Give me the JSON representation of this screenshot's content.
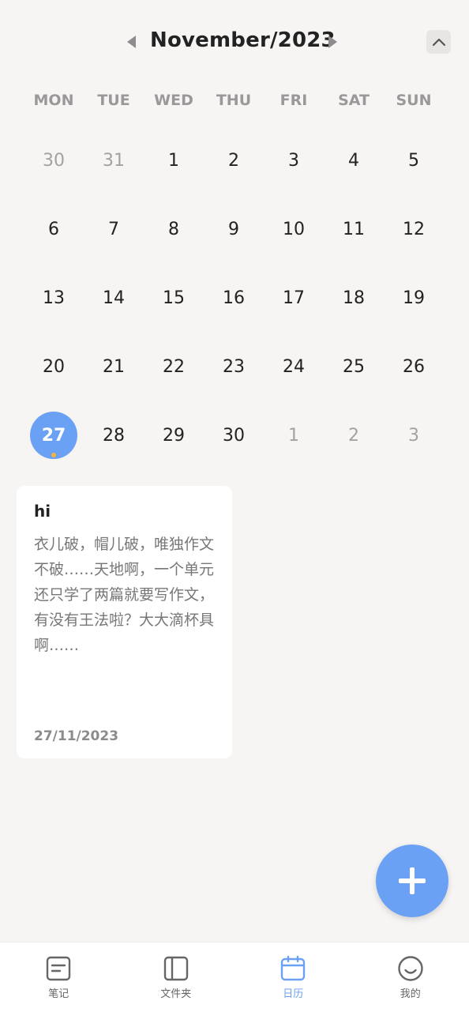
{
  "header": {
    "month_title": "November/2023"
  },
  "weekdays": [
    "MON",
    "TUE",
    "WED",
    "THU",
    "FRI",
    "SAT",
    "SUN"
  ],
  "calendar": {
    "weeks": [
      [
        {
          "d": "30",
          "other": true
        },
        {
          "d": "31",
          "other": true
        },
        {
          "d": "1"
        },
        {
          "d": "2"
        },
        {
          "d": "3"
        },
        {
          "d": "4"
        },
        {
          "d": "5"
        }
      ],
      [
        {
          "d": "6"
        },
        {
          "d": "7"
        },
        {
          "d": "8"
        },
        {
          "d": "9"
        },
        {
          "d": "10"
        },
        {
          "d": "11"
        },
        {
          "d": "12"
        }
      ],
      [
        {
          "d": "13"
        },
        {
          "d": "14"
        },
        {
          "d": "15"
        },
        {
          "d": "16"
        },
        {
          "d": "17"
        },
        {
          "d": "18"
        },
        {
          "d": "19"
        }
      ],
      [
        {
          "d": "20"
        },
        {
          "d": "21"
        },
        {
          "d": "22"
        },
        {
          "d": "23"
        },
        {
          "d": "24"
        },
        {
          "d": "25"
        },
        {
          "d": "26"
        }
      ],
      [
        {
          "d": "27",
          "selected": true,
          "has_note": true
        },
        {
          "d": "28"
        },
        {
          "d": "29"
        },
        {
          "d": "30"
        },
        {
          "d": "1",
          "other": true
        },
        {
          "d": "2",
          "other": true
        },
        {
          "d": "3",
          "other": true
        }
      ]
    ]
  },
  "note": {
    "title": "hi",
    "body": "衣儿破，帽儿破，唯独作文不破……天地啊，一个单元还只学了两篇就要写作文，有没有王法啦？大大滴杯具啊……",
    "date": "27/11/2023"
  },
  "nav": {
    "items": [
      {
        "label": "笔记",
        "icon": "note-icon"
      },
      {
        "label": "文件夹",
        "icon": "folder-icon"
      },
      {
        "label": "日历",
        "icon": "calendar-icon",
        "active": true
      },
      {
        "label": "我的",
        "icon": "smiley-icon"
      }
    ]
  },
  "colors": {
    "accent": "#6aa1f4",
    "note_dot": "#f2b43c",
    "background": "#f7f5f4"
  }
}
